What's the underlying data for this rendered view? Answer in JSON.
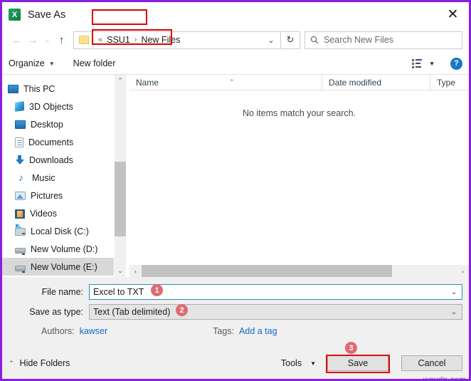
{
  "window": {
    "title": "Save As",
    "app_icon": "excel-icon",
    "app_icon_letter": "X",
    "close_label": "✕",
    "frame_color": "#8B1FE0"
  },
  "navbar": {
    "back_label": "←",
    "forward_label": "→",
    "recent_label": "⌄",
    "up_label": "↑",
    "breadcrumbs": [
      "SSU1",
      "New Files"
    ],
    "separator_first": "«",
    "separator": "›",
    "dropdown_label": "⌄",
    "refresh_label": "↻",
    "search_placeholder": "Search New Files",
    "search_value": "",
    "search_icon": "search-icon"
  },
  "toolbar": {
    "organize_label": "Organize",
    "organize_caret": "▼",
    "new_folder_label": "New folder",
    "view_caret": "▼",
    "help_label": "?"
  },
  "sidebar": {
    "items": [
      {
        "label": "This PC",
        "icon": "monitor-icon",
        "selected": false,
        "root": true
      },
      {
        "label": "3D Objects",
        "icon": "cube-icon",
        "selected": false,
        "root": false
      },
      {
        "label": "Desktop",
        "icon": "monitor-icon",
        "selected": false,
        "root": false
      },
      {
        "label": "Documents",
        "icon": "document-icon",
        "selected": false,
        "root": false
      },
      {
        "label": "Downloads",
        "icon": "download-icon",
        "selected": false,
        "root": false
      },
      {
        "label": "Music",
        "icon": "music-note-icon",
        "selected": false,
        "root": false
      },
      {
        "label": "Pictures",
        "icon": "picture-icon",
        "selected": false,
        "root": false
      },
      {
        "label": "Videos",
        "icon": "video-icon",
        "selected": false,
        "root": false
      },
      {
        "label": "Local Disk (C:)",
        "icon": "disk-icon",
        "selected": false,
        "root": false
      },
      {
        "label": "New Volume (D:)",
        "icon": "drive-icon",
        "selected": false,
        "root": false
      },
      {
        "label": "New Volume (E:)",
        "icon": "drive-icon",
        "selected": true,
        "root": false
      }
    ],
    "scroll_up_label": "⌃",
    "scroll_down_label": "⌄"
  },
  "filelist": {
    "columns": [
      "Name",
      "Date modified",
      "Type"
    ],
    "sort_caret": "⌃",
    "empty_message": "No items match your search.",
    "rows": [],
    "hscroll_left_label": "‹",
    "hscroll_right_label": "›"
  },
  "form": {
    "filename_label": "File name:",
    "filename_value": "Excel to TXT",
    "filetype_label": "Save as type:",
    "filetype_value": "Text (Tab delimited)",
    "combo_caret": "⌄",
    "authors_label": "Authors:",
    "authors_value": "kawser",
    "tags_label": "Tags:",
    "tags_value": "Add a tag"
  },
  "footer": {
    "hide_folders_label": "Hide Folders",
    "hide_folders_caret": "⌃",
    "tools_label": "Tools",
    "tools_caret": "▼",
    "save_label": "Save",
    "cancel_label": "Cancel"
  },
  "annotations": {
    "badge_1": "1",
    "badge_2": "2",
    "badge_3": "3",
    "badge_color": "#E06A72",
    "highlight_color": "#e00000"
  },
  "watermark": "wsxdn.com"
}
